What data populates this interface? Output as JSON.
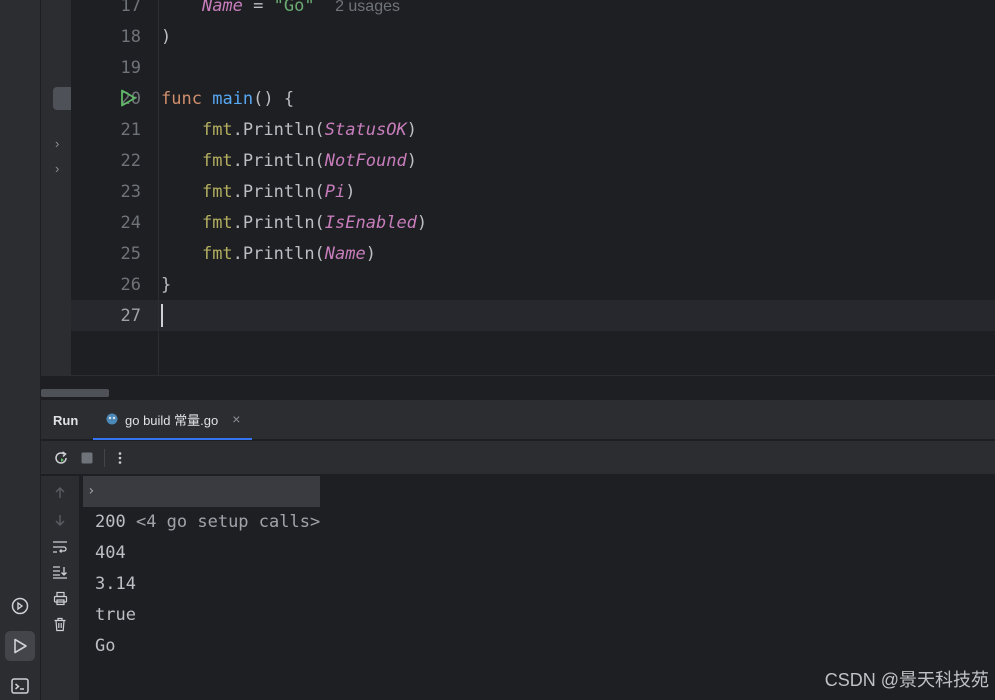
{
  "editor": {
    "lines": [
      {
        "num": "17",
        "parts": [
          {
            "t": "    ",
            "c": ""
          },
          {
            "t": "Name",
            "c": "cst"
          },
          {
            "t": " = ",
            "c": ""
          },
          {
            "t": "\"Go\"",
            "c": "str"
          },
          {
            "t": "  ",
            "c": ""
          },
          {
            "t": "2 usages",
            "c": "hint"
          }
        ]
      },
      {
        "num": "18",
        "parts": [
          {
            "t": ")",
            "c": ""
          }
        ]
      },
      {
        "num": "19",
        "parts": []
      },
      {
        "num": "20",
        "parts": [
          {
            "t": "func",
            "c": "kw"
          },
          {
            "t": " ",
            "c": ""
          },
          {
            "t": "main",
            "c": "fn"
          },
          {
            "t": "() {",
            "c": ""
          }
        ]
      },
      {
        "num": "21",
        "parts": [
          {
            "t": "    ",
            "c": ""
          },
          {
            "t": "fmt",
            "c": "pkg"
          },
          {
            "t": ".Println(",
            "c": ""
          },
          {
            "t": "StatusOK",
            "c": "cst"
          },
          {
            "t": ")",
            "c": ""
          }
        ]
      },
      {
        "num": "22",
        "parts": [
          {
            "t": "    ",
            "c": ""
          },
          {
            "t": "fmt",
            "c": "pkg"
          },
          {
            "t": ".Println(",
            "c": ""
          },
          {
            "t": "NotFound",
            "c": "cst"
          },
          {
            "t": ")",
            "c": ""
          }
        ]
      },
      {
        "num": "23",
        "parts": [
          {
            "t": "    ",
            "c": ""
          },
          {
            "t": "fmt",
            "c": "pkg"
          },
          {
            "t": ".Println(",
            "c": ""
          },
          {
            "t": "Pi",
            "c": "cst"
          },
          {
            "t": ")",
            "c": ""
          }
        ]
      },
      {
        "num": "24",
        "parts": [
          {
            "t": "    ",
            "c": ""
          },
          {
            "t": "fmt",
            "c": "pkg"
          },
          {
            "t": ".Println(",
            "c": ""
          },
          {
            "t": "IsEnabled",
            "c": "cst"
          },
          {
            "t": ")",
            "c": ""
          }
        ]
      },
      {
        "num": "25",
        "parts": [
          {
            "t": "    ",
            "c": ""
          },
          {
            "t": "fmt",
            "c": "pkg"
          },
          {
            "t": ".Println(",
            "c": ""
          },
          {
            "t": "Name",
            "c": "cst"
          },
          {
            "t": ")",
            "c": ""
          }
        ]
      },
      {
        "num": "26",
        "parts": [
          {
            "t": "}",
            "c": ""
          }
        ]
      },
      {
        "num": "27",
        "parts": []
      }
    ],
    "current_line": "27"
  },
  "run_panel": {
    "title": "Run",
    "tab_label": "go build 常量.go",
    "tab_close": "×"
  },
  "console": {
    "setup_label": "<4 go setup calls>",
    "output": [
      "200",
      "404",
      "3.14",
      "true",
      "Go"
    ]
  },
  "watermark": "CSDN @景天科技苑",
  "icons": {
    "run_gutter": "play-icon",
    "rerun": "rerun-icon",
    "stop": "stop-icon",
    "more": "more-vertical-icon",
    "up": "arrow-up-icon",
    "down": "arrow-down-icon",
    "wrap": "soft-wrap-icon",
    "scroll_end": "scroll-to-end-icon",
    "print": "print-icon",
    "trash": "trash-icon",
    "services": "services-icon",
    "run_tool": "run-tool-icon",
    "terminal": "terminal-icon"
  },
  "colors": {
    "keyword": "#cf8e6d",
    "function": "#56a8f5",
    "package": "#b3ae60",
    "constant": "#c77dbb",
    "string": "#6aab73",
    "accent": "#3574f0"
  }
}
